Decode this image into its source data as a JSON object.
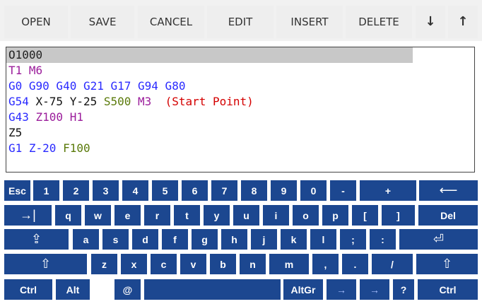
{
  "toolbar": {
    "open": "OPEN",
    "save": "SAVE",
    "cancel": "CANCEL",
    "edit": "EDIT",
    "insert": "INSERT",
    "delete": "DELETE",
    "down": "↓",
    "up": "↑"
  },
  "editor": {
    "lines": [
      {
        "parts": [
          {
            "t": "O1000",
            "c": "prog"
          }
        ]
      },
      {
        "parts": [
          {
            "t": "T1 M6",
            "c": "tool"
          }
        ]
      },
      {
        "parts": [
          {
            "t": "G0 G90 G40 G21 G17 G94 G80",
            "c": "g"
          }
        ]
      },
      {
        "parts": [
          {
            "t": "G54 ",
            "c": "g"
          },
          {
            "t": "X-75 Y-25 ",
            "c": "axis"
          },
          {
            "t": "S500 ",
            "c": "s"
          },
          {
            "t": "M3  ",
            "c": "m"
          },
          {
            "t": "(Start Point)",
            "c": "comment"
          }
        ]
      },
      {
        "parts": [
          {
            "t": "G43 ",
            "c": "g"
          },
          {
            "t": "Z100 H1",
            "c": "tool"
          }
        ]
      },
      {
        "parts": [
          {
            "t": "Z5",
            "c": "axis"
          }
        ]
      },
      {
        "parts": [
          {
            "t": "G1 ",
            "c": "g"
          },
          {
            "t": "Z-20 ",
            "c": "g"
          },
          {
            "t": "F100",
            "c": "s"
          }
        ]
      }
    ]
  },
  "keyboard": {
    "rows": [
      [
        {
          "label": "Esc"
        },
        {
          "label": "1"
        },
        {
          "label": "2"
        },
        {
          "label": "3"
        },
        {
          "label": "4"
        },
        {
          "label": "5"
        },
        {
          "label": "6"
        },
        {
          "label": "7"
        },
        {
          "label": "8"
        },
        {
          "label": "9"
        },
        {
          "label": "0"
        },
        {
          "label": "-"
        },
        {
          "label": "+"
        },
        {
          "label": "⟵",
          "big": true
        }
      ],
      [
        {
          "label": "→|",
          "big": true
        },
        {
          "label": "q"
        },
        {
          "label": "w"
        },
        {
          "label": "e"
        },
        {
          "label": "r"
        },
        {
          "label": "t"
        },
        {
          "label": "y"
        },
        {
          "label": "u"
        },
        {
          "label": "i"
        },
        {
          "label": "o"
        },
        {
          "label": "p"
        },
        {
          "label": "["
        },
        {
          "label": "]"
        },
        {
          "label": "Del"
        }
      ],
      [
        {
          "label": "⇪",
          "big": true
        },
        {
          "label": "a"
        },
        {
          "label": "s"
        },
        {
          "label": "d"
        },
        {
          "label": "f"
        },
        {
          "label": "g"
        },
        {
          "label": "h"
        },
        {
          "label": "j"
        },
        {
          "label": "k"
        },
        {
          "label": "l"
        },
        {
          "label": ";"
        },
        {
          "label": ":"
        },
        {
          "label": "⏎",
          "big": true
        }
      ],
      [
        {
          "label": "⇧",
          "big": true
        },
        {
          "label": "z"
        },
        {
          "label": "x"
        },
        {
          "label": "c"
        },
        {
          "label": "v"
        },
        {
          "label": "b"
        },
        {
          "label": "n"
        },
        {
          "label": "m"
        },
        {
          "label": ","
        },
        {
          "label": "."
        },
        {
          "label": "/"
        },
        {
          "label": "⇧",
          "big": true
        }
      ],
      [
        {
          "label": "Ctrl"
        },
        {
          "label": "Alt"
        },
        {
          "label": "@"
        },
        {
          "label": ""
        },
        {
          "label": "AltGr"
        },
        {
          "label": "→",
          "light": true
        },
        {
          "label": "→",
          "light": true
        },
        {
          "label": "?"
        },
        {
          "label": "Ctrl"
        }
      ]
    ]
  }
}
